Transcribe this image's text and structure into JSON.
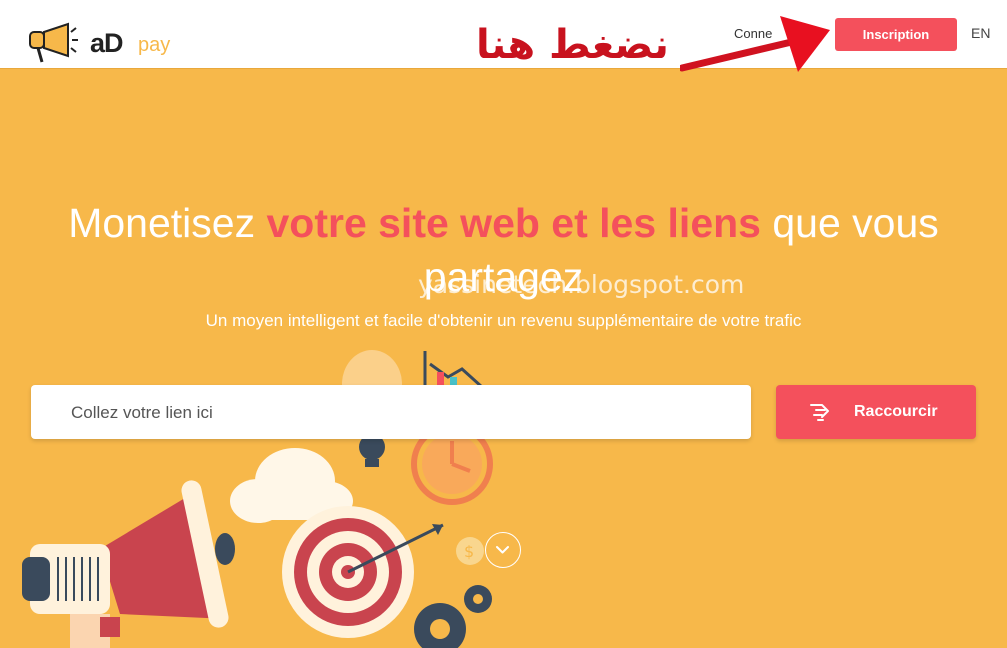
{
  "header": {
    "logo_text": "aD",
    "logo_suffix": "pay",
    "login_label": "Conne",
    "signup_label": "Inscription",
    "language": "EN"
  },
  "annotation": {
    "text": "نضغط هنا",
    "color": "#c8121e"
  },
  "watermark": {
    "text": "yassinetech.blogspot.com"
  },
  "hero": {
    "title_part1": "Monetisez ",
    "title_highlight": "votre site web et les liens",
    "title_part2": " que vous partagez",
    "subtitle": "Un moyen intelligent et facile d'obtenir un revenu supplémentaire de votre trafic",
    "link_placeholder": "Collez votre lien ici",
    "shorten_label": "Raccourcir"
  },
  "colors": {
    "background": "#f7b84a",
    "accent": "#f4505c",
    "annotation": "#c8121e"
  },
  "icons": [
    "megaphone-logo-icon",
    "arrow-annotation-icon",
    "scissors-link-icon",
    "chevron-down-icon",
    "megaphone-illustration",
    "target-illustration",
    "clock-illustration",
    "cloud-illustration",
    "gear-illustration",
    "bulb-illustration",
    "chart-illustration"
  ]
}
